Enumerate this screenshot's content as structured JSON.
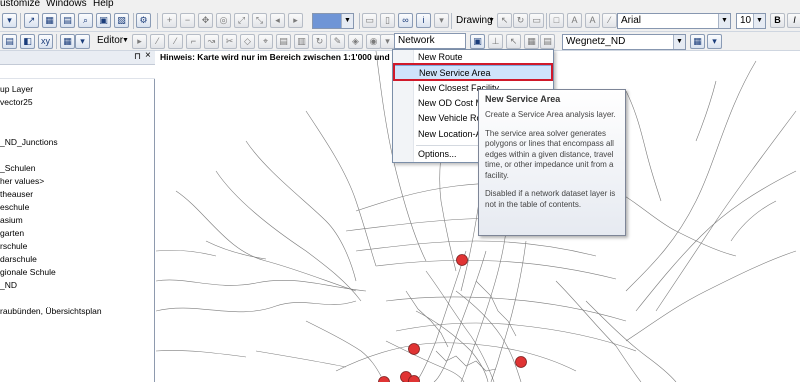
{
  "menubar": {
    "items": [
      "ustomize",
      "Windows",
      "Help"
    ]
  },
  "toolbar1": {
    "scale_combo": "",
    "drawing_label": "Drawing",
    "font_name": "Arial",
    "font_size": "10",
    "bold": "B",
    "italic": "I"
  },
  "toolbar2": {
    "editor_label": "Editor",
    "network_analyst_label": "Network Analyst",
    "network_combo": "Wegnetz_ND"
  },
  "toc": {
    "items": [
      "up Layer",
      "vector25",
      "_ND_Junctions",
      "_Schulen",
      "her values>",
      "theauser",
      "eschule",
      "asium",
      "garten",
      "rschule",
      "darschule",
      "gionale Schule",
      "_ND",
      "raubünden, Übersichtsplan"
    ]
  },
  "map": {
    "hint": "Hinweis: Karte wird nur im Bereich zwischen 1:1'000 und 1:"
  },
  "na_menu": {
    "items": [
      "New Route",
      "New Service Area",
      "New Closest Facility",
      "New OD Cost Matrix",
      "New Vehicle Routing Problem",
      "New Location-Allocation",
      "Options..."
    ],
    "highlighted": "New Service Area"
  },
  "tooltip": {
    "title": "New Service Area",
    "p1": "Create a Service Area analysis layer.",
    "p2": "The service area solver generates polygons or lines that encompass all edges within a given distance, travel time, or other impedance unit from a facility.",
    "p3": "Disabled if a network dataset layer is not in the table of contents."
  },
  "colors": {
    "highlight_frame": "#d0192a",
    "facility_point": "#e03434",
    "menu_highlight": "#cfe3fb"
  }
}
